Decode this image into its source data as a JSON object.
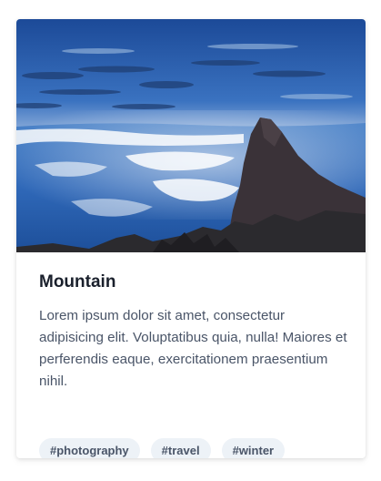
{
  "card": {
    "image_alt": "Mountain",
    "title": "Mountain",
    "text": "Lorem ipsum dolor sit amet, consectetur adipisicing elit. Voluptatibus quia, nulla! Maiores et perferendis eaque, exercitationem praesentium nihil.",
    "tags": [
      {
        "label": "#photography"
      },
      {
        "label": "#travel"
      },
      {
        "label": "#winter"
      }
    ]
  },
  "colors": {
    "title": "#1a202c",
    "body_text": "#4a5568",
    "tag_background": "#edf2f7",
    "sky_top": "#1f4f9e",
    "sea_of_clouds": "#3f78c4",
    "mountain": "#3a3238"
  }
}
